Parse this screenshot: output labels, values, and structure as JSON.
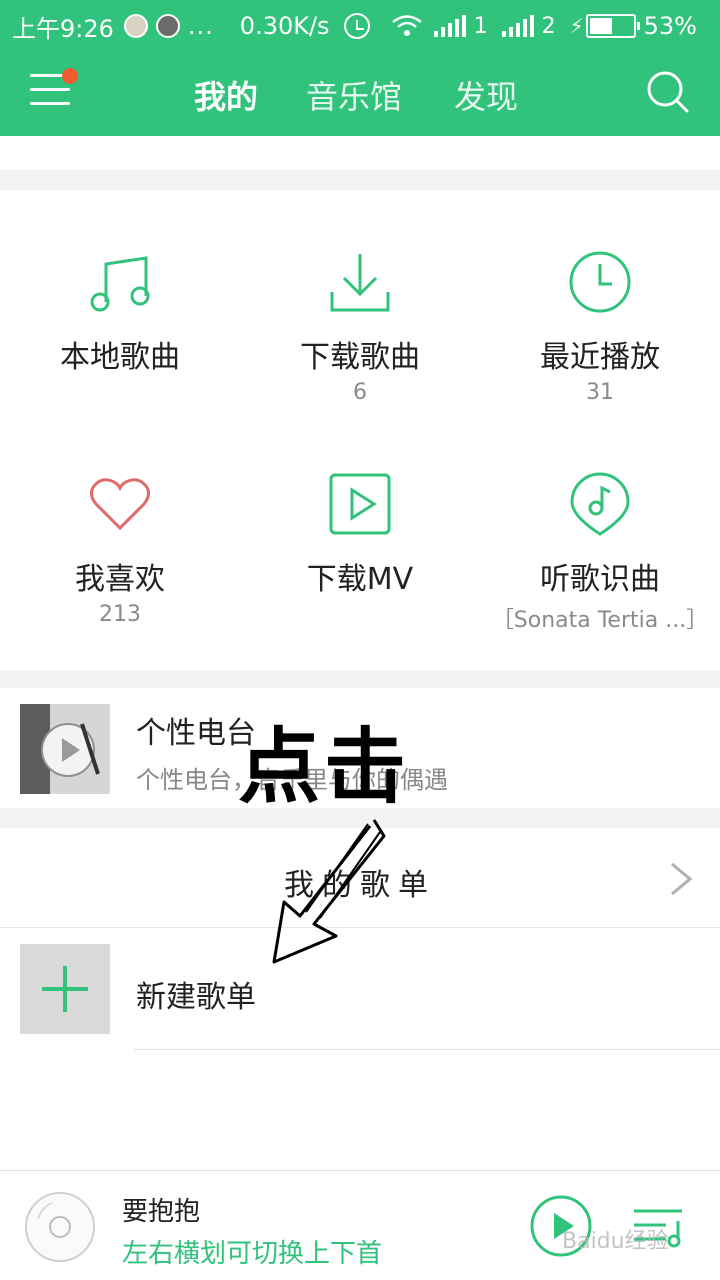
{
  "status_bar": {
    "time": "上午9:26",
    "more": "...",
    "net_speed": "0.30K/s",
    "sim1": "1",
    "sim2": "2",
    "battery_percent": "53%",
    "battery_level": 0.53
  },
  "header": {
    "tabs": [
      {
        "label": "我的",
        "active": true
      },
      {
        "label": "音乐馆",
        "active": false
      },
      {
        "label": "发现",
        "active": false
      }
    ],
    "accent_color": "#31c27c",
    "notification_dot_color": "#f25a2f"
  },
  "grid": [
    {
      "label": "本地歌曲",
      "count": "",
      "icon": "music-note-icon"
    },
    {
      "label": "下载歌曲",
      "count": "6",
      "icon": "download-icon"
    },
    {
      "label": "最近播放",
      "count": "31",
      "icon": "clock-icon"
    },
    {
      "label": "我喜欢",
      "count": "213",
      "icon": "heart-icon"
    },
    {
      "label": "下载MV",
      "count": "",
      "icon": "play-box-icon"
    },
    {
      "label": "听歌识曲",
      "count": "［Sonata Tertia ...］",
      "icon": "music-recognize-icon"
    }
  ],
  "radio": {
    "title": "个性电台",
    "subtitle": "个性电台，音乐里与你的偶遇"
  },
  "playlists": {
    "header": "我的歌单",
    "new_playlist_label": "新建歌单"
  },
  "annotation": {
    "text": "点击"
  },
  "player": {
    "song": "要抱抱",
    "hint": "左右横划可切换上下首",
    "watermark": "Baidu经验"
  }
}
